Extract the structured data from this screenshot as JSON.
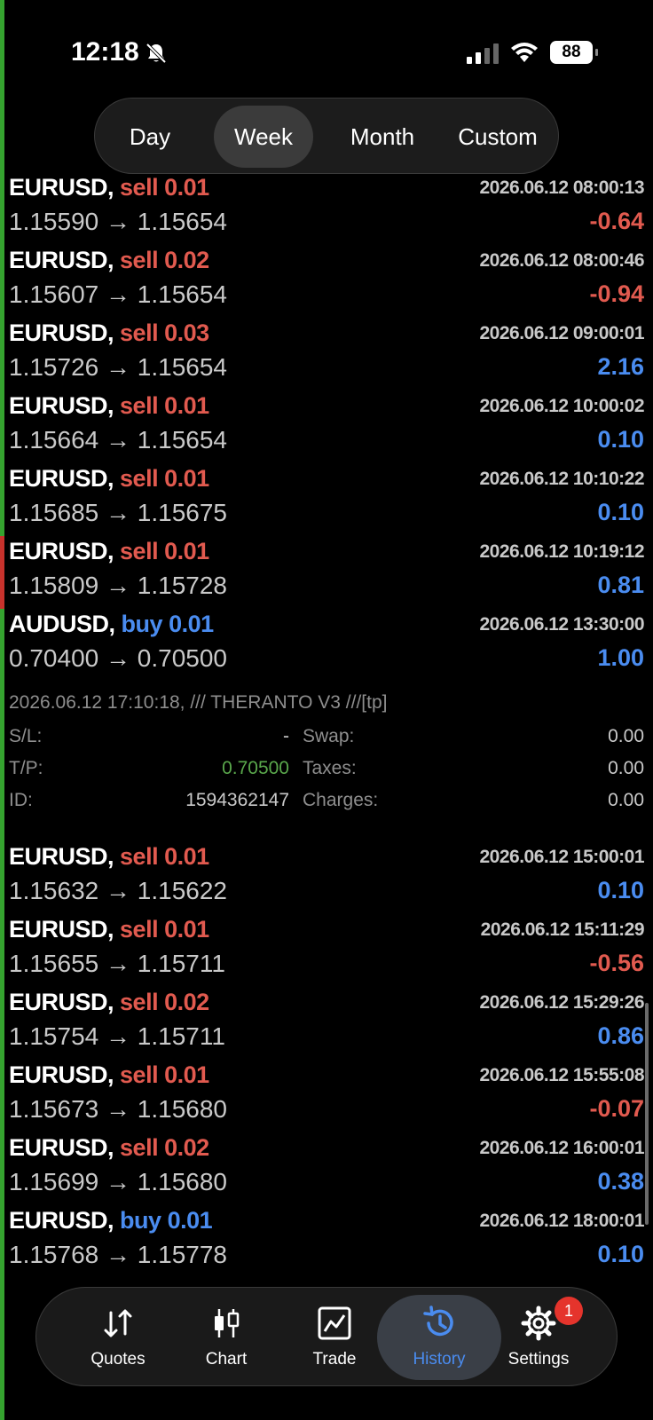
{
  "status_bar": {
    "time": "12:18",
    "battery": "88"
  },
  "period_filter": {
    "tabs": [
      "Day",
      "Week",
      "Month",
      "Custom"
    ],
    "active": "Week"
  },
  "colors": {
    "sell": "#e15a4f",
    "buy": "#4a8cf0",
    "positive": "#4a8cf0",
    "negative": "#e15a4f",
    "accent_green": "#35a32f"
  },
  "trades": [
    {
      "symbol": "EURUSD,",
      "side": "sell",
      "volume": "0.01",
      "time": "2026.06.12 08:00:13",
      "prices": "1.15590 → 1.15654",
      "profit": "-0.64"
    },
    {
      "symbol": "EURUSD,",
      "side": "sell",
      "volume": "0.02",
      "time": "2026.06.12 08:00:46",
      "prices": "1.15607 → 1.15654",
      "profit": "-0.94"
    },
    {
      "symbol": "EURUSD,",
      "side": "sell",
      "volume": "0.03",
      "time": "2026.06.12 09:00:01",
      "prices": "1.15726 → 1.15654",
      "profit": "2.16"
    },
    {
      "symbol": "EURUSD,",
      "side": "sell",
      "volume": "0.01",
      "time": "2026.06.12 10:00:02",
      "prices": "1.15664 → 1.15654",
      "profit": "0.10"
    },
    {
      "symbol": "EURUSD,",
      "side": "sell",
      "volume": "0.01",
      "time": "2026.06.12 10:10:22",
      "prices": "1.15685 → 1.15675",
      "profit": "0.10"
    },
    {
      "symbol": "EURUSD,",
      "side": "sell",
      "volume": "0.01",
      "time": "2026.06.12 10:19:12",
      "prices": "1.15809 → 1.15728",
      "profit": "0.81"
    },
    {
      "symbol": "AUDUSD,",
      "side": "buy",
      "volume": "0.01",
      "time": "2026.06.12 13:30:00",
      "prices": "0.70400 → 0.70500",
      "profit": "1.00"
    },
    {
      "symbol": "EURUSD,",
      "side": "sell",
      "volume": "0.01",
      "time": "2026.06.12 15:00:01",
      "prices": "1.15632 → 1.15622",
      "profit": "0.10"
    },
    {
      "symbol": "EURUSD,",
      "side": "sell",
      "volume": "0.01",
      "time": "2026.06.12 15:11:29",
      "prices": "1.15655 → 1.15711",
      "profit": "-0.56"
    },
    {
      "symbol": "EURUSD,",
      "side": "sell",
      "volume": "0.02",
      "time": "2026.06.12 15:29:26",
      "prices": "1.15754 → 1.15711",
      "profit": "0.86"
    },
    {
      "symbol": "EURUSD,",
      "side": "sell",
      "volume": "0.01",
      "time": "2026.06.12 15:55:08",
      "prices": "1.15673 → 1.15680",
      "profit": "-0.07"
    },
    {
      "symbol": "EURUSD,",
      "side": "sell",
      "volume": "0.02",
      "time": "2026.06.12 16:00:01",
      "prices": "1.15699 → 1.15680",
      "profit": "0.38"
    },
    {
      "symbol": "EURUSD,",
      "side": "buy",
      "volume": "0.01",
      "time": "2026.06.12 18:00:01",
      "prices": "1.15768 → 1.15778",
      "profit": "0.10"
    }
  ],
  "expanded_details": {
    "comment": "2026.06.12 17:10:18, /// THERANTO V3 ///[tp]",
    "sl_label": "S/L:",
    "sl_value": "-",
    "tp_label": "T/P:",
    "tp_value": "0.70500",
    "id_label": "ID:",
    "id_value": "1594362147",
    "swap_label": "Swap:",
    "swap_value": "0.00",
    "taxes_label": "Taxes:",
    "taxes_value": "0.00",
    "charges_label": "Charges:",
    "charges_value": "0.00"
  },
  "bottom_nav": {
    "tabs": [
      {
        "label": "Quotes",
        "icon": "quotes-arrows-icon"
      },
      {
        "label": "Chart",
        "icon": "candlestick-chart-icon"
      },
      {
        "label": "Trade",
        "icon": "trade-chart-icon"
      },
      {
        "label": "History",
        "icon": "history-clock-icon"
      },
      {
        "label": "Settings",
        "icon": "gear-icon"
      }
    ],
    "active": "History",
    "settings_badge": "1"
  }
}
